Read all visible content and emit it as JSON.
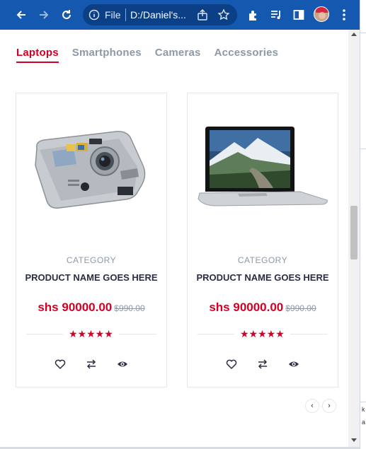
{
  "browser": {
    "omnibox_label": "File",
    "url": "D:/Daniel's..."
  },
  "icons": {
    "back": "arrow-left-icon",
    "forward": "arrow-right-icon",
    "reload": "reload-icon",
    "info": "info-icon",
    "share": "share-icon",
    "bookmark": "star-icon",
    "extensions": "puzzle-icon",
    "media": "media-queue-icon",
    "sidepanel": "side-panel-icon",
    "menu": "kebab-menu-icon",
    "wishlist": "heart-icon",
    "compare": "compare-arrows-icon",
    "quickview": "eye-icon"
  },
  "tabs": [
    {
      "label": "Laptops",
      "active": true
    },
    {
      "label": "Smartphones",
      "active": false
    },
    {
      "label": "Cameras",
      "active": false
    },
    {
      "label": "Accessories",
      "active": false
    }
  ],
  "products": [
    {
      "image": "digital-camera",
      "category": "CATEGORY",
      "name": "PRODUCT NAME GOES HERE",
      "price": "shs 90000.00",
      "old_price": "$990.00",
      "rating": "★★★★★"
    },
    {
      "image": "laptop",
      "category": "CATEGORY",
      "name": "PRODUCT NAME GOES HERE",
      "price": "shs 90000.00",
      "old_price": "$990.00",
      "rating": "★★★★★"
    }
  ],
  "slider_nav": {
    "prev": "‹",
    "next": "›"
  },
  "desktop_edge": {
    "text_1": "k",
    "text_2": "a"
  },
  "colors": {
    "chrome_bar": "#1558b0",
    "accent": "#d10024",
    "muted": "#8d99a6",
    "heading": "#2b2d42"
  }
}
